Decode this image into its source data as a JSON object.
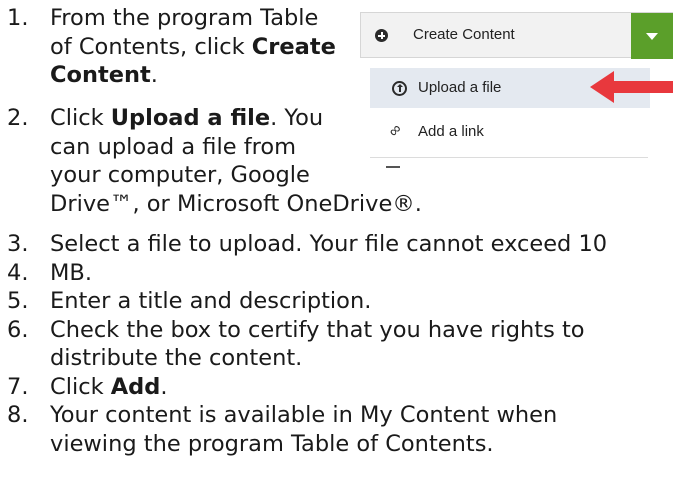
{
  "steps": [
    {
      "number": "1.",
      "lines": [
        {
          "text": "From the program Table"
        },
        {
          "pre": "of Contents, click ",
          "bold": "Create"
        },
        {
          "bold": "Content",
          "post": "."
        }
      ]
    },
    {
      "number": "2.",
      "lines": [
        {
          "pre": "Click ",
          "bold": "Upload a file",
          "post": ". You"
        },
        {
          "text": "can upload a file from"
        },
        {
          "text": "your computer, Google"
        },
        {
          "text": "Drive™, or Microsoft OneDrive®."
        }
      ]
    },
    {
      "number": "3.",
      "lines": [
        {
          "text": "Select a file to upload. Your file cannot exceed 10"
        }
      ]
    },
    {
      "number": "4.",
      "lines": [
        {
          "text": "MB."
        }
      ]
    },
    {
      "number": "5.",
      "lines": [
        {
          "text": "Enter a title and description."
        }
      ]
    },
    {
      "number": "6.",
      "lines": [
        {
          "text": "Check the box to certify that you have rights to"
        },
        {
          "text": "distribute the content."
        }
      ]
    },
    {
      "number": "7.",
      "lines": [
        {
          "pre": "Click ",
          "bold": "Add",
          "post": "."
        }
      ]
    },
    {
      "number": "8.",
      "lines": [
        {
          "text": "Your content is available in My Content when"
        },
        {
          "text": "viewing the program Table of Contents."
        }
      ]
    }
  ],
  "inset": {
    "create_button_label": "Create Content",
    "create_icon": "plus-circle-icon",
    "dropdown_icon": "caret-down-icon",
    "menu_items": [
      {
        "label": "Upload a file",
        "icon": "upload-icon",
        "highlighted": true
      },
      {
        "label": "Add a link",
        "icon": "link-icon",
        "highlighted": false
      }
    ],
    "arrow_color": "#e8383d",
    "accent_color": "#5b9f2a",
    "highlight_color": "#e4e9f0"
  }
}
